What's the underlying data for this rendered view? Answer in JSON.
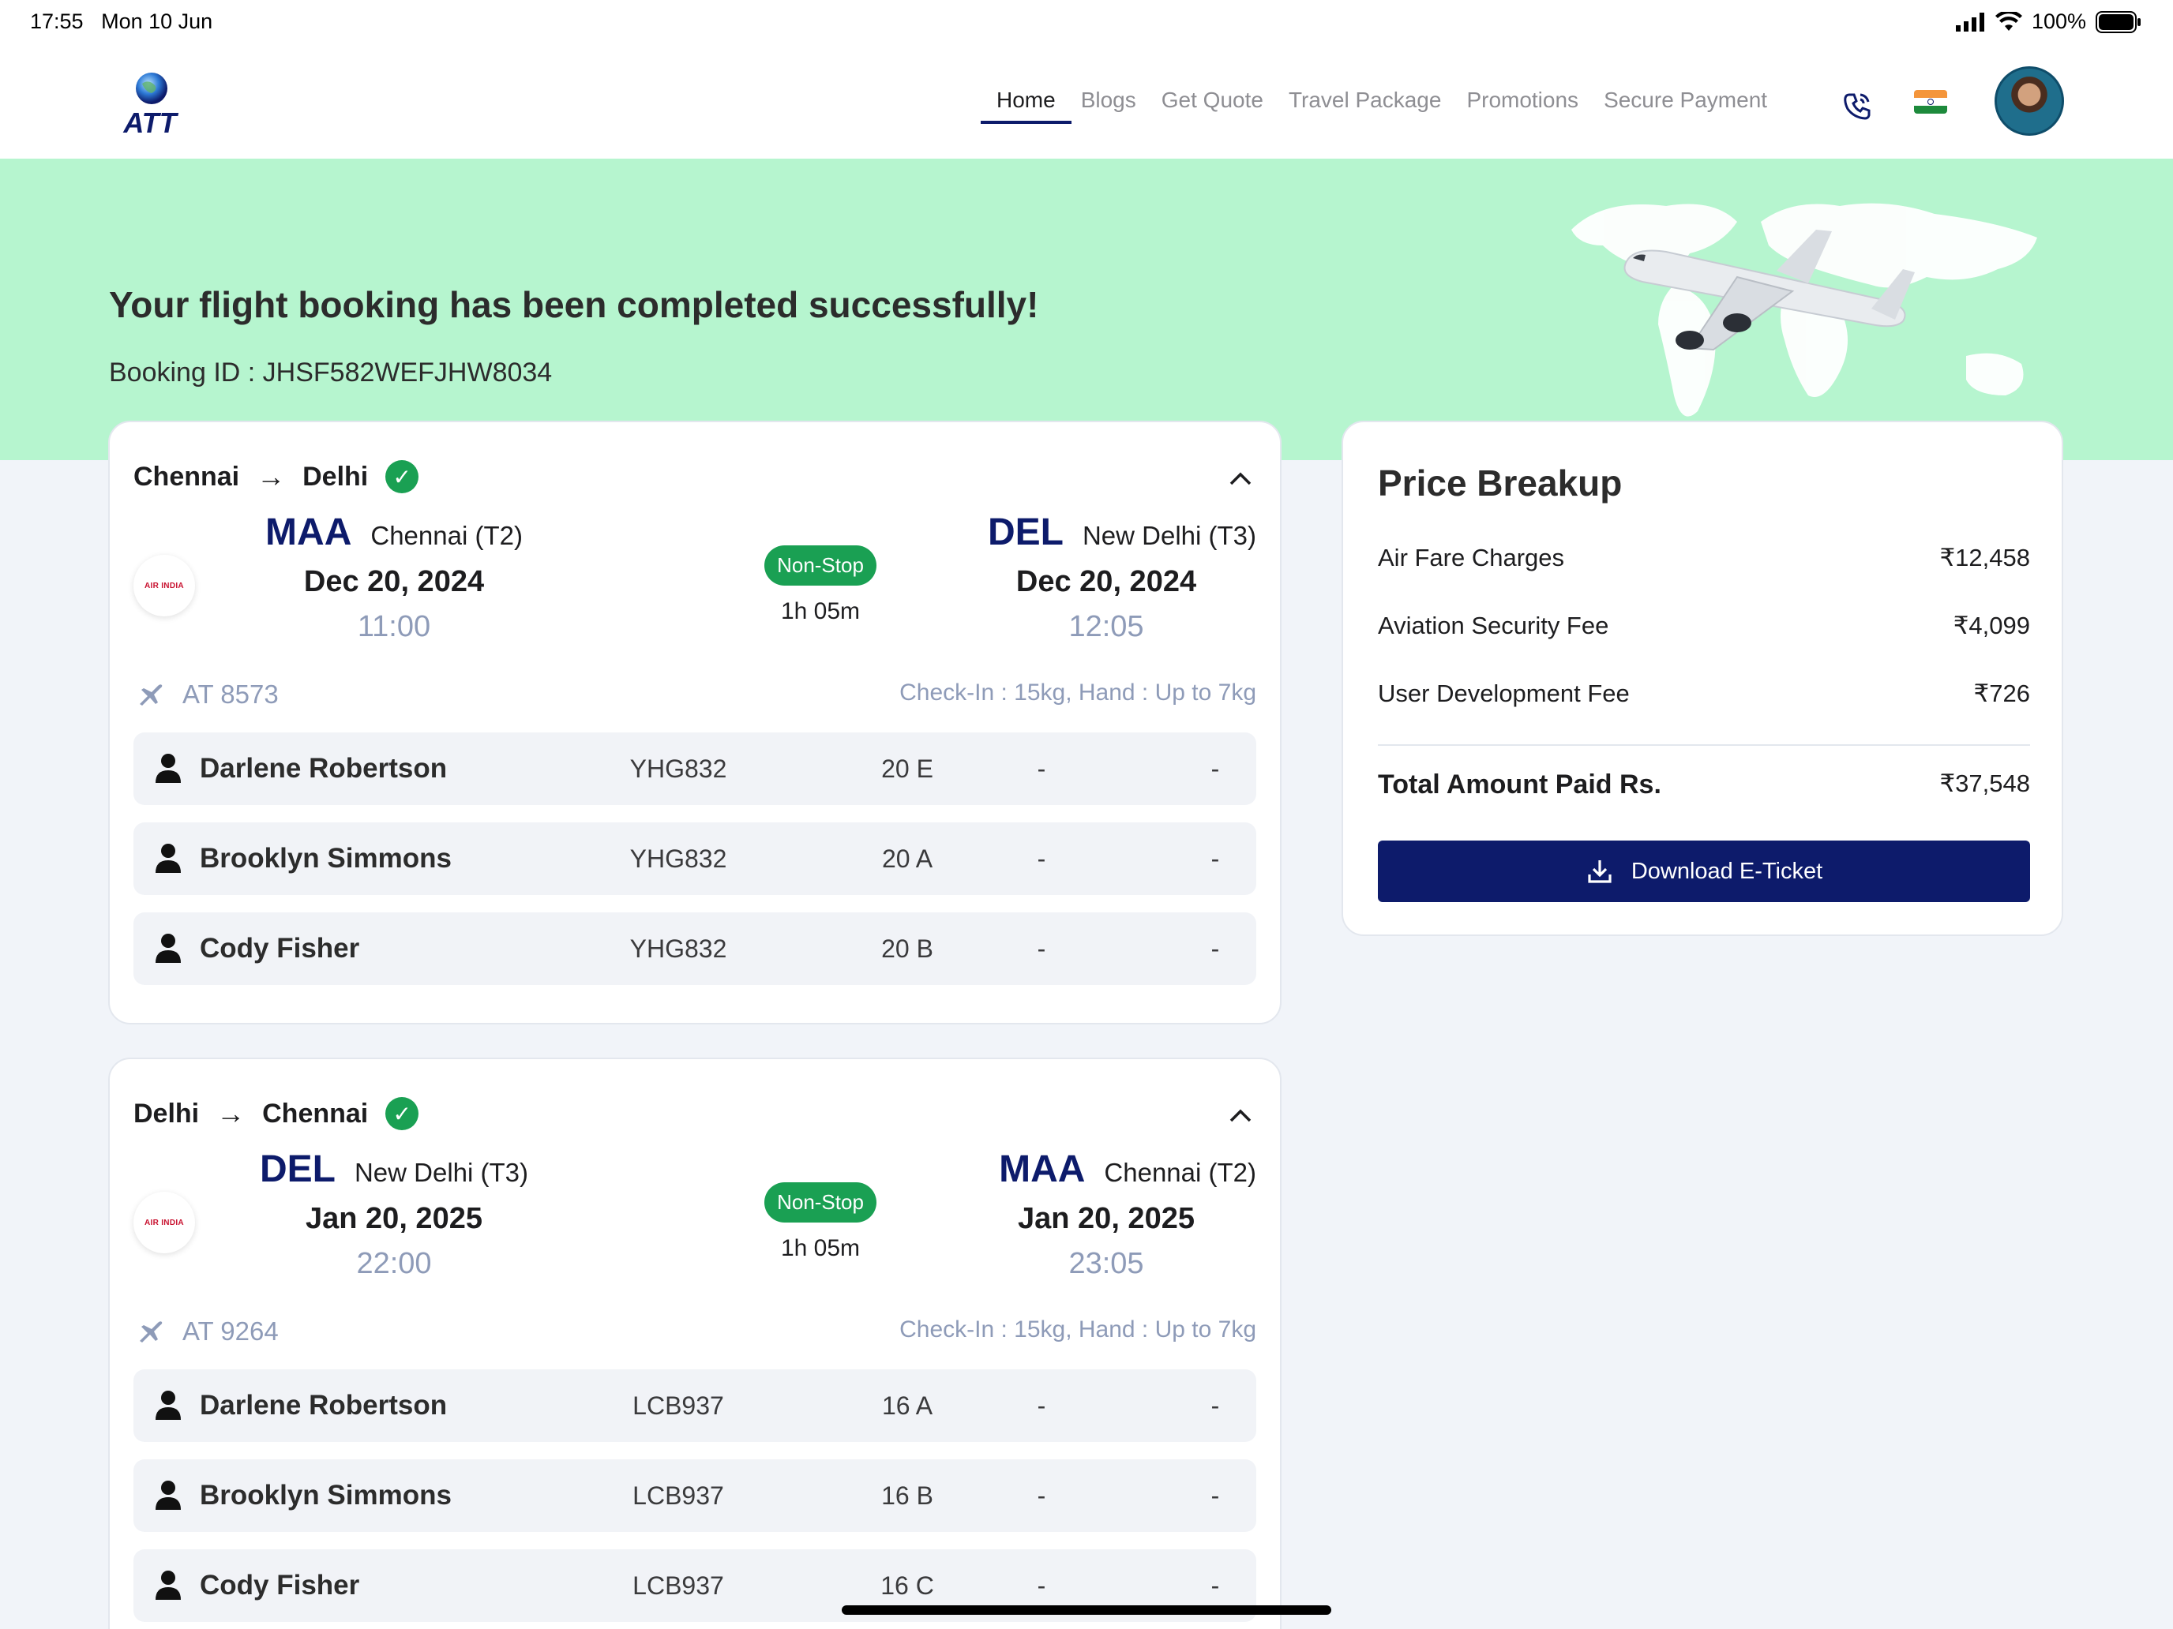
{
  "status_bar": {
    "time": "17:55",
    "date": "Mon 10 Jun",
    "battery": "100%"
  },
  "header": {
    "logo_text": "ATT",
    "nav": [
      {
        "label": "Home",
        "active": true
      },
      {
        "label": "Blogs",
        "active": false
      },
      {
        "label": "Get Quote",
        "active": false
      },
      {
        "label": "Travel Package",
        "active": false
      },
      {
        "label": "Promotions",
        "active": false
      },
      {
        "label": "Secure Payment",
        "active": false
      }
    ],
    "icons": [
      "phone-icon",
      "india-flag-icon",
      "avatar"
    ]
  },
  "hero": {
    "title": "Your flight booking has been completed successfully!",
    "booking_id": "Booking ID : JHSF582WEFJHW8034",
    "background": "#b6f5cf"
  },
  "flights": [
    {
      "from": "Chennai",
      "to": "Delhi",
      "airline_logo": "AIR INDIA",
      "dep": {
        "code": "MAA",
        "city": "Chennai (T2)",
        "date": "Dec 20, 2024",
        "time": "11:00"
      },
      "arr": {
        "code": "DEL",
        "city": "New Delhi (T3)",
        "date": "Dec 20, 2024",
        "time": "12:05"
      },
      "stop": "Non-Stop",
      "duration": "1h 05m",
      "flight_no": "AT 8573",
      "baggage": "Check-In : 15kg, Hand : Up to 7kg",
      "passengers": [
        {
          "name": "Darlene Robertson",
          "pnr": "YHG832",
          "seat": "20 E",
          "c1": "-",
          "c2": "-"
        },
        {
          "name": "Brooklyn Simmons",
          "pnr": "YHG832",
          "seat": "20 A",
          "c1": "-",
          "c2": "-"
        },
        {
          "name": "Cody Fisher",
          "pnr": "YHG832",
          "seat": "20 B",
          "c1": "-",
          "c2": "-"
        }
      ]
    },
    {
      "from": "Delhi",
      "to": "Chennai",
      "airline_logo": "AIR INDIA",
      "dep": {
        "code": "DEL",
        "city": "New Delhi (T3)",
        "date": "Jan 20, 2025",
        "time": "22:00"
      },
      "arr": {
        "code": "MAA",
        "city": "Chennai (T2)",
        "date": "Jan 20, 2025",
        "time": "23:05"
      },
      "stop": "Non-Stop",
      "duration": "1h 05m",
      "flight_no": "AT 9264",
      "baggage": "Check-In : 15kg, Hand : Up to 7kg",
      "passengers": [
        {
          "name": "Darlene Robertson",
          "pnr": "LCB937",
          "seat": "16 A",
          "c1": "-",
          "c2": "-"
        },
        {
          "name": "Brooklyn Simmons",
          "pnr": "LCB937",
          "seat": "16 B",
          "c1": "-",
          "c2": "-"
        },
        {
          "name": "Cody Fisher",
          "pnr": "LCB937",
          "seat": "16 C",
          "c1": "-",
          "c2": "-"
        }
      ]
    }
  ],
  "price": {
    "title": "Price Breakup",
    "rows": [
      {
        "label": "Air Fare Charges",
        "amount": "₹12,458"
      },
      {
        "label": "Aviation Security Fee",
        "amount": "₹4,099"
      },
      {
        "label": "User Development Fee",
        "amount": "₹726"
      }
    ],
    "total_label": "Total Amount Paid Rs.",
    "total_amount": "₹37,548",
    "download_label": "Download E-Ticket"
  },
  "colors": {
    "brand": "#0d1b6b",
    "success": "#1aa053",
    "muted": "#8e9bb8"
  }
}
